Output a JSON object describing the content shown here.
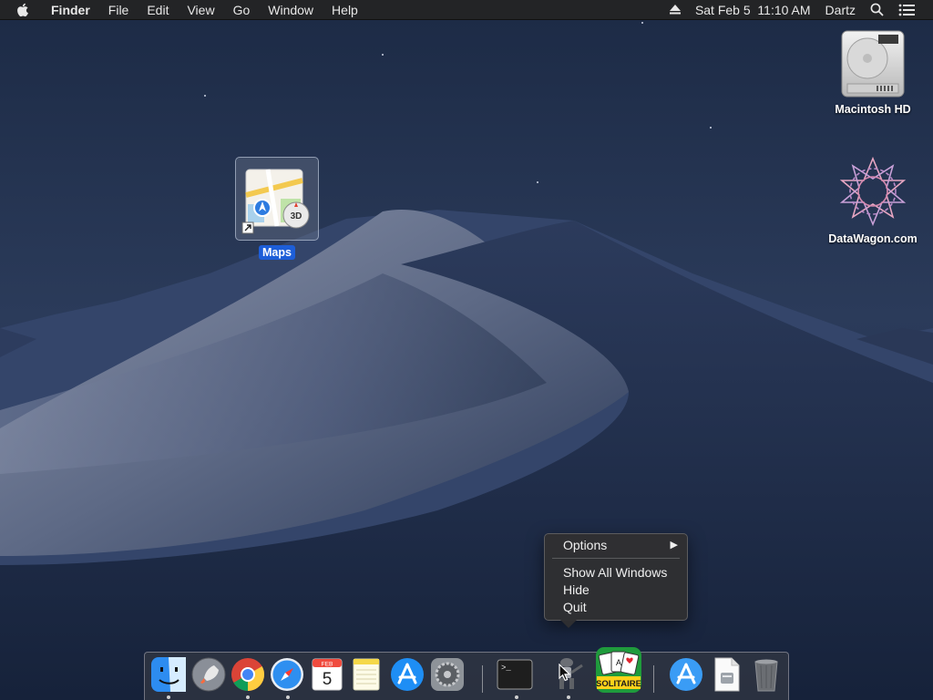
{
  "menubar": {
    "apple_icon": "apple-logo-icon",
    "app_name": "Finder",
    "menus": [
      "File",
      "Edit",
      "View",
      "Go",
      "Window",
      "Help"
    ],
    "status": {
      "eject_icon": "eject-icon",
      "datetime": "Sat Feb 5  11:10 AM",
      "user": "Dartz",
      "search_icon": "spotlight-search-icon",
      "notification_icon": "notification-center-icon"
    }
  },
  "desktop": {
    "icons": [
      {
        "label": "Macintosh HD",
        "icon": "hard-drive-icon"
      },
      {
        "label": "DataWagon.com",
        "icon": "network-volume-icon"
      },
      {
        "label": "Maps",
        "icon": "maps-alias-icon",
        "badge": "3D",
        "selected": true
      }
    ]
  },
  "context_menu": {
    "items": [
      "Options",
      "Show All Windows",
      "Hide",
      "Quit"
    ],
    "submenu_arrow": "▶"
  },
  "dock": {
    "apps": [
      {
        "name": "Finder",
        "icon": "finder-icon",
        "running": true
      },
      {
        "name": "Launchpad",
        "icon": "launchpad-icon",
        "running": false
      },
      {
        "name": "Google Chrome",
        "icon": "chrome-icon",
        "running": true
      },
      {
        "name": "Safari",
        "icon": "safari-icon",
        "running": true
      },
      {
        "name": "Calendar",
        "icon": "calendar-icon",
        "running": false,
        "month": "FEB",
        "day": "5"
      },
      {
        "name": "Notes",
        "icon": "notes-icon",
        "running": false
      },
      {
        "name": "App Store",
        "icon": "app-store-icon",
        "running": false
      },
      {
        "name": "System Preferences",
        "icon": "system-preferences-icon",
        "running": false
      },
      {
        "name": "Terminal",
        "icon": "terminal-icon",
        "running": true,
        "prompt": ">_"
      },
      {
        "name": "Automator",
        "icon": "automator-icon",
        "running": true
      },
      {
        "name": "Solitaire",
        "icon": "solitaire-icon",
        "running": false,
        "caption": "SOLITAIRE"
      },
      {
        "name": "Applications",
        "icon": "applications-folder-icon",
        "running": false
      },
      {
        "name": "Document",
        "icon": "document-stack-icon",
        "running": false
      },
      {
        "name": "Trash",
        "icon": "trash-icon",
        "running": false
      }
    ]
  }
}
